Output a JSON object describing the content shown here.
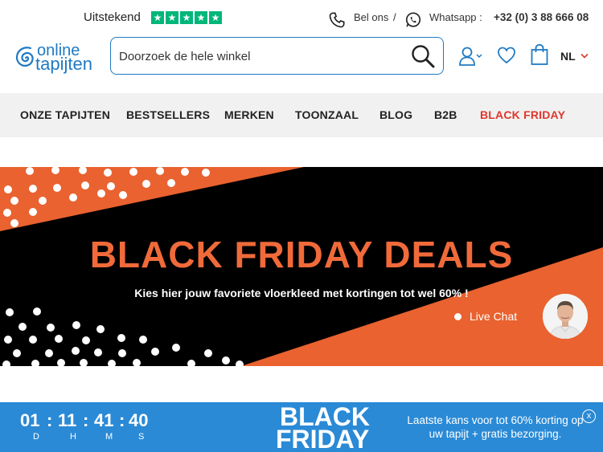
{
  "topbar": {
    "trust_label": "Uitstekend",
    "stars": [
      "★",
      "★",
      "★",
      "★",
      "★"
    ],
    "call_label": "Bel ons",
    "separator": "/",
    "whatsapp_label": "Whatsapp :",
    "phone_number": "+32 (0) 3 88 666 08"
  },
  "header": {
    "logo_line1": "online",
    "logo_line2": "tapijten",
    "search_placeholder": "Doorzoek de hele winkel",
    "language": "NL"
  },
  "nav": {
    "items": [
      "ONZE TAPIJTEN",
      "BESTSELLERS",
      "MERKEN",
      "TOONZAAL",
      "BLOG",
      "B2B",
      "BLACK FRIDAY"
    ]
  },
  "banner": {
    "title": "BLACK FRIDAY DEALS",
    "subtitle": "Kies hier jouw favoriete vloerkleed met kortingen tot wel 60% !"
  },
  "chat": {
    "label": "Live Chat"
  },
  "promo": {
    "countdown": [
      "01",
      "11",
      "41",
      "40"
    ],
    "units": [
      "D",
      "H",
      "M",
      "S"
    ],
    "colon": ":",
    "black": "BLACK",
    "friday": "FRIDAY",
    "text": "Laatste kans voor tot 60% korting op uw tapijt + gratis bezorging.",
    "close": "x"
  },
  "colors": {
    "brand_blue": "#1f7ac4",
    "accent_red": "#e0362c",
    "banner_orange": "#e9622f",
    "promo_blue": "#2a8ad6",
    "trustpilot_green": "#00b67a"
  }
}
